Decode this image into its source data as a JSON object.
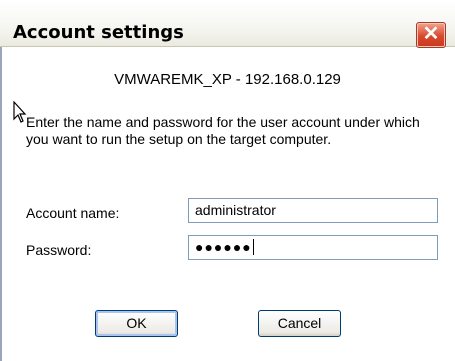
{
  "window": {
    "title": "Account settings",
    "close_glyph": "✕"
  },
  "host_label": "VMWAREMK_XP - 192.168.0.129",
  "instructions": "Enter the name and password for the user account under which you want to run the setup on the target computer.",
  "account_name": {
    "label": "Account name:",
    "value": "administrator"
  },
  "password": {
    "label": "Password:",
    "masked_value": "●●●●●●"
  },
  "buttons": {
    "ok": "OK",
    "cancel": "Cancel"
  },
  "colors": {
    "close_button": "#d9492e",
    "field_border": "#7f9db9",
    "button_border": "#003c74"
  }
}
